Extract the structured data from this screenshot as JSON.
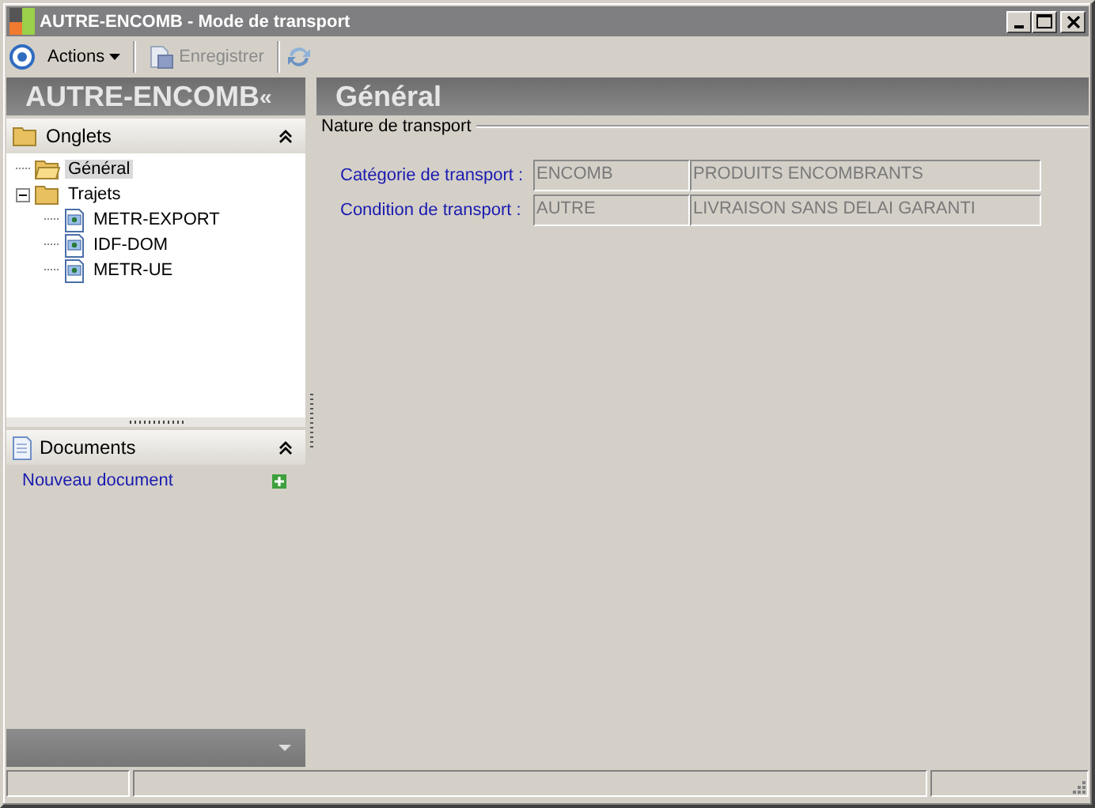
{
  "window": {
    "title": "AUTRE-ENCOMB - Mode de transport"
  },
  "toolbar": {
    "actions": "Actions",
    "save": {
      "label": "Enregistrer",
      "disabled": true
    }
  },
  "sidebar": {
    "title": "AUTRE-ENCOMB",
    "collapse": "«",
    "tabs_section": {
      "title": "Onglets",
      "expanded": true,
      "tree": [
        {
          "label": "Général",
          "kind": "folder",
          "selected": true
        },
        {
          "label": "Trajets",
          "kind": "folder",
          "selected": false,
          "expanded": true,
          "children": [
            {
              "label": "METR-EXPORT",
              "kind": "document",
              "selected": false
            },
            {
              "label": "IDF-DOM",
              "kind": "document",
              "selected": false
            },
            {
              "label": "METR-UE",
              "kind": "document",
              "selected": false
            }
          ]
        }
      ]
    },
    "documents_section": {
      "title": "Documents",
      "expanded": true,
      "link": "Nouveau document"
    }
  },
  "content": {
    "title": "Général",
    "group": "Nature de transport",
    "fields": [
      {
        "label": "Catégorie de transport :",
        "code": "ENCOMB",
        "description": "PRODUITS ENCOMBRANTS"
      },
      {
        "label": "Condition de transport :",
        "code": "AUTRE",
        "description": "LIVRAISON SANS DELAI GARANTI"
      }
    ]
  }
}
